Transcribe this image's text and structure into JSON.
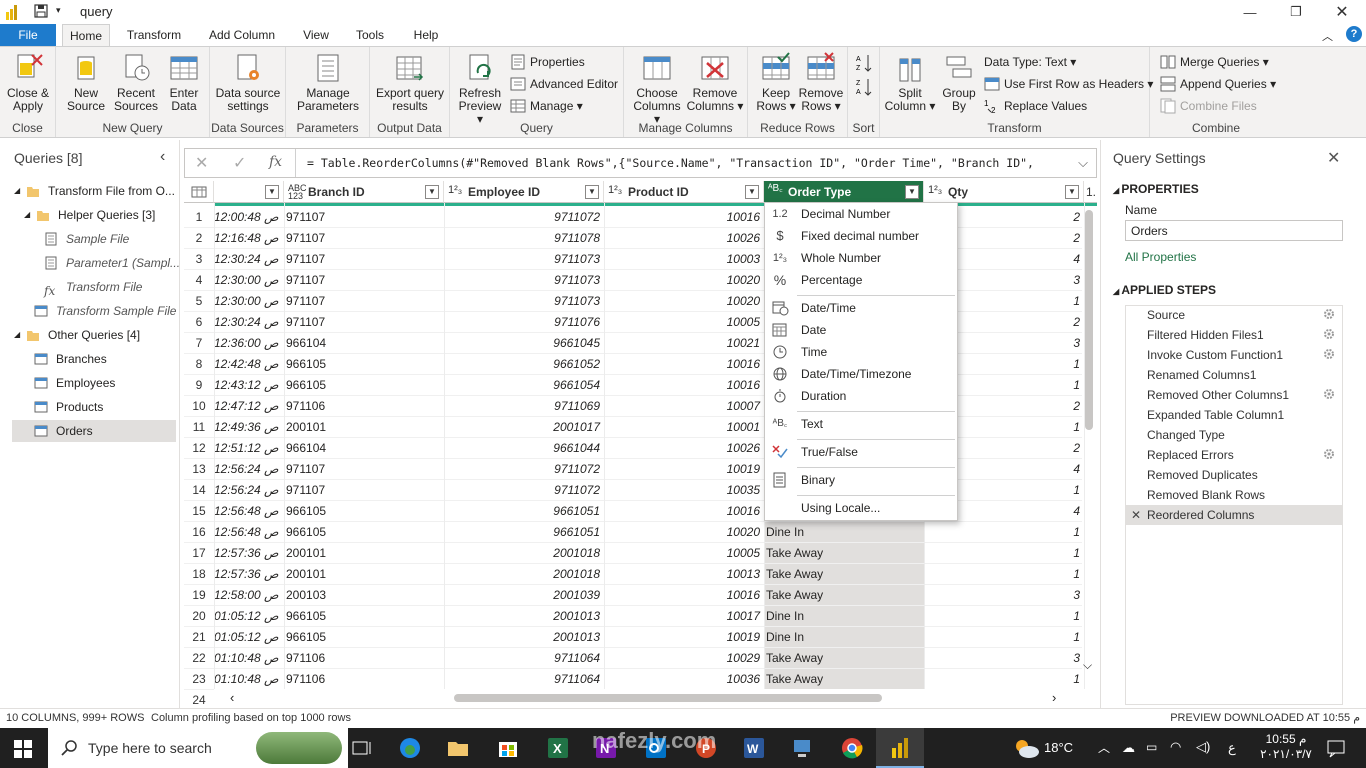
{
  "window": {
    "title": "query"
  },
  "tabs": [
    {
      "label": "File"
    },
    {
      "label": "Home"
    },
    {
      "label": "Transform"
    },
    {
      "label": "Add Column"
    },
    {
      "label": "View"
    },
    {
      "label": "Tools"
    },
    {
      "label": "Help"
    }
  ],
  "ribbon": {
    "close_apply": "Close &\nApply",
    "close_apply_1": "Close &",
    "close_apply_2": "Apply",
    "new_source_1": "New",
    "new_source_2": "Source",
    "recent_sources_1": "Recent",
    "recent_sources_2": "Sources",
    "enter_data_1": "Enter",
    "enter_data_2": "Data",
    "data_source_settings_1": "Data source",
    "data_source_settings_2": "settings",
    "manage_parameters_1": "Manage",
    "manage_parameters_2": "Parameters",
    "export_query_1": "Export query",
    "export_query_2": "results",
    "refresh_1": "Refresh",
    "refresh_2": "Preview",
    "properties": "Properties",
    "advanced_editor": "Advanced Editor",
    "manage": "Manage",
    "choose_columns_1": "Choose",
    "choose_columns_2": "Columns",
    "remove_columns_1": "Remove",
    "remove_columns_2": "Columns",
    "keep_rows_1": "Keep",
    "keep_rows_2": "Rows",
    "remove_rows_1": "Remove",
    "remove_rows_2": "Rows",
    "split_column_1": "Split",
    "split_column_2": "Column",
    "group_by_1": "Group",
    "group_by_2": "By",
    "data_type": "Data Type: Text",
    "use_first_row": "Use First Row as Headers",
    "replace_values": "Replace Values",
    "merge_queries": "Merge Queries",
    "append_queries": "Append Queries",
    "combine_files": "Combine Files",
    "groups": {
      "close": "Close",
      "new_query": "New Query",
      "data_sources": "Data Sources",
      "parameters": "Parameters",
      "output_data": "Output Data",
      "query": "Query",
      "manage_columns": "Manage Columns",
      "reduce_rows": "Reduce Rows",
      "sort": "Sort",
      "transform": "Transform",
      "combine": "Combine"
    }
  },
  "queries": {
    "header": "Queries [8]",
    "items": [
      {
        "label": "Transform File from O..."
      },
      {
        "label": "Helper Queries [3]"
      },
      {
        "label": "Sample File"
      },
      {
        "label": "Parameter1 (Sampl..."
      },
      {
        "label": "Transform File"
      },
      {
        "label": "Transform Sample File"
      },
      {
        "label": "Other Queries [4]"
      },
      {
        "label": "Branches"
      },
      {
        "label": "Employees"
      },
      {
        "label": "Products"
      },
      {
        "label": "Orders"
      }
    ]
  },
  "formula": {
    "text": "= Table.ReorderColumns(#\"Removed Blank Rows\",{\"Source.Name\", \"Transaction ID\", \"Order Time\", \"Branch ID\","
  },
  "grid": {
    "columns": [
      {
        "type": "ABC\n123",
        "type_1": "ABC",
        "type_2": "123",
        "name": "Branch ID"
      },
      {
        "type_1": "1",
        "type_2": "2 3",
        "name": "Employee ID"
      },
      {
        "type_1": "1",
        "type_2": "2 3",
        "name": "Product ID"
      },
      {
        "type_1": "A",
        "type_2": "BC",
        "name": "Order Type"
      },
      {
        "type_1": "1",
        "type_2": "2 3",
        "name": "Qty"
      }
    ],
    "last_col_hint": "1.",
    "rows": [
      {
        "n": "1",
        "time": "12:00:48 ص",
        "branch": "971107",
        "emp": "9711072",
        "prod": "10016",
        "type": "",
        "qty": "2"
      },
      {
        "n": "2",
        "time": "12:16:48 ص",
        "branch": "971107",
        "emp": "9711078",
        "prod": "10026",
        "type": "",
        "qty": "2"
      },
      {
        "n": "3",
        "time": "12:30:24 ص",
        "branch": "971107",
        "emp": "9711073",
        "prod": "10003",
        "type": "",
        "qty": "4"
      },
      {
        "n": "4",
        "time": "12:30:00 ص",
        "branch": "971107",
        "emp": "9711073",
        "prod": "10020",
        "type": "",
        "qty": "3"
      },
      {
        "n": "5",
        "time": "12:30:00 ص",
        "branch": "971107",
        "emp": "9711073",
        "prod": "10020",
        "type": "",
        "qty": "1"
      },
      {
        "n": "6",
        "time": "12:30:24 ص",
        "branch": "971107",
        "emp": "9711076",
        "prod": "10005",
        "type": "",
        "qty": "2"
      },
      {
        "n": "7",
        "time": "12:36:00 ص",
        "branch": "966104",
        "emp": "9661045",
        "prod": "10021",
        "type": "",
        "qty": "3"
      },
      {
        "n": "8",
        "time": "12:42:48 ص",
        "branch": "966105",
        "emp": "9661052",
        "prod": "10016",
        "type": "",
        "qty": "1"
      },
      {
        "n": "9",
        "time": "12:43:12 ص",
        "branch": "966105",
        "emp": "9661054",
        "prod": "10016",
        "type": "",
        "qty": "1"
      },
      {
        "n": "10",
        "time": "12:47:12 ص",
        "branch": "971106",
        "emp": "9711069",
        "prod": "10007",
        "type": "",
        "qty": "2"
      },
      {
        "n": "11",
        "time": "12:49:36 ص",
        "branch": "200101",
        "emp": "2001017",
        "prod": "10001",
        "type": "",
        "qty": "1"
      },
      {
        "n": "12",
        "time": "12:51:12 ص",
        "branch": "966104",
        "emp": "9661044",
        "prod": "10026",
        "type": "",
        "qty": "2"
      },
      {
        "n": "13",
        "time": "12:56:24 ص",
        "branch": "971107",
        "emp": "9711072",
        "prod": "10019",
        "type": "",
        "qty": "4"
      },
      {
        "n": "14",
        "time": "12:56:24 ص",
        "branch": "971107",
        "emp": "9711072",
        "prod": "10035",
        "type": "",
        "qty": "1"
      },
      {
        "n": "15",
        "time": "12:56:48 ص",
        "branch": "966105",
        "emp": "9661051",
        "prod": "10016",
        "type": "",
        "qty": "4"
      },
      {
        "n": "16",
        "time": "12:56:48 ص",
        "branch": "966105",
        "emp": "9661051",
        "prod": "10020",
        "type": "Dine In",
        "qty": "1"
      },
      {
        "n": "17",
        "time": "12:57:36 ص",
        "branch": "200101",
        "emp": "2001018",
        "prod": "10005",
        "type": "Take Away",
        "qty": "1"
      },
      {
        "n": "18",
        "time": "12:57:36 ص",
        "branch": "200101",
        "emp": "2001018",
        "prod": "10013",
        "type": "Take Away",
        "qty": "1"
      },
      {
        "n": "19",
        "time": "12:58:00 ص",
        "branch": "200103",
        "emp": "2001039",
        "prod": "10016",
        "type": "Take Away",
        "qty": "3"
      },
      {
        "n": "20",
        "time": "01:05:12 ص",
        "branch": "966105",
        "emp": "2001013",
        "prod": "10017",
        "type": "Dine In",
        "qty": "1"
      },
      {
        "n": "21",
        "time": "01:05:12 ص",
        "branch": "966105",
        "emp": "2001013",
        "prod": "10019",
        "type": "Dine In",
        "qty": "1"
      },
      {
        "n": "22",
        "time": "01:10:48 ص",
        "branch": "971106",
        "emp": "9711064",
        "prod": "10029",
        "type": "Take Away",
        "qty": "3"
      },
      {
        "n": "23",
        "time": "01:10:48 ص",
        "branch": "971106",
        "emp": "9711064",
        "prod": "10036",
        "type": "Take Away",
        "qty": "1"
      },
      {
        "n": "24",
        "time": "",
        "branch": "",
        "emp": "",
        "prod": "",
        "type": "",
        "qty": ""
      }
    ]
  },
  "type_menu": {
    "items": [
      {
        "icon": "1.2",
        "label": "Decimal Number"
      },
      {
        "icon": "$",
        "label": "Fixed decimal number"
      },
      {
        "icon": "123",
        "label": "Whole Number"
      },
      {
        "icon": "%",
        "label": "Percentage"
      },
      {
        "icon": "datetime",
        "label": "Date/Time"
      },
      {
        "icon": "date",
        "label": "Date"
      },
      {
        "icon": "time",
        "label": "Time"
      },
      {
        "icon": "globe",
        "label": "Date/Time/Timezone"
      },
      {
        "icon": "stopwatch",
        "label": "Duration"
      },
      {
        "icon": "ABC",
        "label": "Text"
      },
      {
        "icon": "truefalse",
        "label": "True/False"
      },
      {
        "icon": "binary",
        "label": "Binary"
      },
      {
        "icon": "",
        "label": "Using Locale..."
      }
    ]
  },
  "settings": {
    "title": "Query Settings",
    "properties_header": "PROPERTIES",
    "name_label": "Name",
    "name_value": "Orders",
    "all_properties": "All Properties",
    "applied_steps_header": "APPLIED STEPS",
    "steps": [
      {
        "label": "Source",
        "gear": true
      },
      {
        "label": "Filtered Hidden Files1",
        "gear": true
      },
      {
        "label": "Invoke Custom Function1",
        "gear": true
      },
      {
        "label": "Renamed Columns1",
        "gear": false
      },
      {
        "label": "Removed Other Columns1",
        "gear": true
      },
      {
        "label": "Expanded Table Column1",
        "gear": false
      },
      {
        "label": "Changed Type",
        "gear": false
      },
      {
        "label": "Replaced Errors",
        "gear": true
      },
      {
        "label": "Removed Duplicates",
        "gear": false
      },
      {
        "label": "Removed Blank Rows",
        "gear": false
      },
      {
        "label": "Reordered Columns",
        "gear": false
      }
    ]
  },
  "status": {
    "left": "10 COLUMNS, 999+ ROWS",
    "middle": "Column profiling based on top 1000 rows",
    "right": "PREVIEW DOWNLOADED AT 10:55 م"
  },
  "taskbar": {
    "search": "Type here to search",
    "weather": "18°C",
    "time": "10:55 م",
    "date": "٢٠٢١/٠٣/٧",
    "lang": "ع"
  },
  "watermark": "nafezly.com",
  "colors": {
    "accent": "#217346",
    "file_tab": "#1e7bcc",
    "taskbar": "#202020"
  }
}
